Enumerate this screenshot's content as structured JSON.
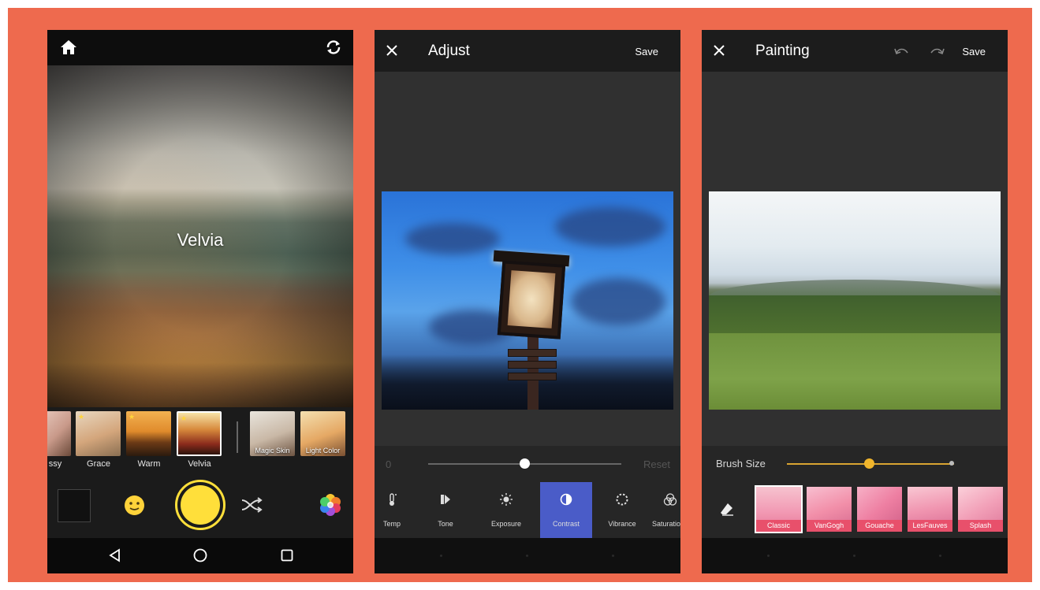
{
  "camera_screen": {
    "current_filter_label": "Velvia",
    "filters": [
      {
        "name": "ssy",
        "starred": false
      },
      {
        "name": "Grace",
        "starred": true
      },
      {
        "name": "Warm",
        "starred": true
      },
      {
        "name": "Velvia",
        "starred": true,
        "selected": true
      },
      {
        "name": "Magic Skin",
        "starred": false
      },
      {
        "name": "Light Color",
        "starred": false
      }
    ],
    "icons": [
      "home-icon",
      "refresh-icon",
      "face-icon",
      "shutter-button",
      "shuffle-icon",
      "flower-icon",
      "back-icon",
      "home-circle-icon",
      "recents-icon"
    ],
    "shutter_color": "#ffdf3a"
  },
  "adjust_screen": {
    "title": "Adjust",
    "save_label": "Save",
    "slider": {
      "min_label": "0",
      "reset_label": "Reset",
      "value": 0.5
    },
    "tools": [
      {
        "label": "Temp",
        "icon": "thermometer-icon"
      },
      {
        "label": "Tone",
        "icon": "tone-icon"
      },
      {
        "label": "Exposure",
        "icon": "sun-icon"
      },
      {
        "label": "Contrast",
        "icon": "contrast-icon",
        "active": true
      },
      {
        "label": "Vibrance",
        "icon": "vibrance-icon"
      },
      {
        "label": "Saturatio",
        "icon": "saturation-icon"
      }
    ],
    "active_color": "#4a5cc8"
  },
  "painting_screen": {
    "title": "Painting",
    "save_label": "Save",
    "brush_label": "Brush Size",
    "brush_value": 0.5,
    "styles": [
      {
        "name": "Classic",
        "selected": true
      },
      {
        "name": "VanGogh"
      },
      {
        "name": "Gouache"
      },
      {
        "name": "LesFauves"
      },
      {
        "name": "Splash"
      }
    ],
    "accent_color": "#f0b52c"
  },
  "background_color": "#ee6a4e"
}
